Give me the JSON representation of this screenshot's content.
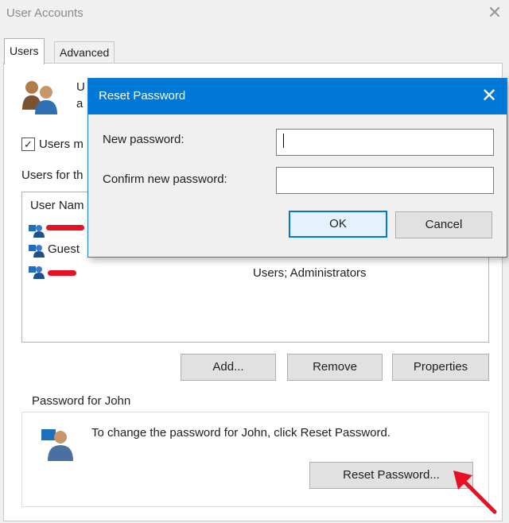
{
  "window": {
    "title": "User Accounts"
  },
  "tabs": [
    {
      "label": "Users"
    },
    {
      "label": "Advanced"
    }
  ],
  "users_panel": {
    "intro_line1": "U",
    "intro_line2": "a",
    "must_enter_checkbox_label": "Users m",
    "users_for_label": "Users for th",
    "column_header": "User Nam",
    "rows": [
      {
        "name": "",
        "group": ""
      },
      {
        "name": "Guest",
        "group": ""
      },
      {
        "name": "",
        "group": "Users; Administrators"
      }
    ],
    "buttons": {
      "add": "Add...",
      "remove": "Remove",
      "properties": "Properties"
    }
  },
  "password_group": {
    "legend": "Password for John",
    "description": "To change the password for John, click Reset Password.",
    "reset_button": "Reset Password..."
  },
  "dialog": {
    "title": "Reset Password",
    "new_password_label": "New password:",
    "confirm_label": "Confirm new password:",
    "ok": "OK",
    "cancel": "Cancel",
    "new_password_value": "",
    "confirm_value": ""
  },
  "colors": {
    "accent": "#0078d7",
    "annotation_arrow": "#e81123"
  },
  "icons": [
    "users-icon",
    "user-icon",
    "key-user-icon",
    "close-icon",
    "arrow-annotation-icon"
  ]
}
